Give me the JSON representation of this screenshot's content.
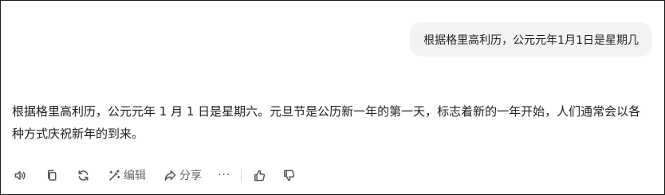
{
  "user_message": {
    "text": "根据格里高利历，公元元年1月1日是星期几"
  },
  "assistant_message": {
    "text": "根据格里高利历，公元元年 1 月 1 日是星期六。元旦节是公历新一年的第一天，标志着新的一年开始，人们通常会以各种方式庆祝新年的到来。"
  },
  "actions": {
    "read_aloud": {
      "icon": "speaker-icon"
    },
    "copy": {
      "icon": "copy-icon"
    },
    "regenerate": {
      "icon": "refresh-icon"
    },
    "edit": {
      "icon": "magic-wand-icon",
      "label": "编辑"
    },
    "share": {
      "icon": "share-arrow-icon",
      "label": "分享"
    },
    "more": {
      "icon": "more-dots-icon",
      "label": "···"
    },
    "like": {
      "icon": "thumbs-up-icon"
    },
    "dislike": {
      "icon": "thumbs-down-icon"
    }
  }
}
